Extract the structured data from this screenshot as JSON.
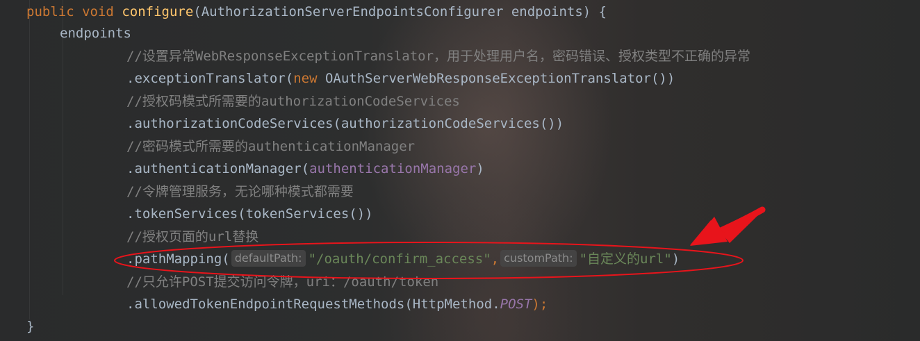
{
  "code": {
    "line1": {
      "kw_public": "public",
      "kw_void": "void",
      "method_name": "configure",
      "params": "(AuthorizationServerEndpointsConfigurer endpoints) {"
    },
    "line2": {
      "text": "endpoints"
    },
    "line3": {
      "comment": "//设置异常WebResponseExceptionTranslator，用于处理用户名，密码错误、授权类型不正确的异常"
    },
    "line4": {
      "call": ".exceptionTranslator(",
      "kw_new": "new",
      "rest": " OAuthServerWebResponseExceptionTranslator())"
    },
    "line5": {
      "comment": "//授权码模式所需要的authorizationCodeServices"
    },
    "line6": {
      "text": ".authorizationCodeServices(authorizationCodeServices())"
    },
    "line7": {
      "comment": "//密码模式所需要的authenticationManager"
    },
    "line8": {
      "call": ".authenticationManager(",
      "field": "authenticationManager",
      "close": ")"
    },
    "line9": {
      "comment": "//令牌管理服务，无论哪种模式都需要"
    },
    "line10": {
      "text": ".tokenServices(tokenServices())"
    },
    "line11": {
      "comment": "//授权页面的url替换"
    },
    "line12": {
      "call": ".pathMapping(",
      "hint_default": "defaultPath:",
      "str_default": "\"/oauth/confirm_access\"",
      "comma": ",",
      "hint_custom": "customPath:",
      "str_custom": "\"自定义的url\"",
      "close": ")"
    },
    "line13": {
      "comment": "//只允许POST提交访问令牌，uri：/oauth/token"
    },
    "line14": {
      "call": ".allowedTokenEndpointRequestMethods(HttpMethod.",
      "constant": "POST",
      "close": ");"
    },
    "line15": {
      "text": "}"
    }
  },
  "colors": {
    "keyword": "#cc7832",
    "method": "#ffc66d",
    "comment": "#808080",
    "string": "#6a8759",
    "field": "#9876aa",
    "default_text": "#a9b7c6",
    "annotation": "#e8141b"
  }
}
